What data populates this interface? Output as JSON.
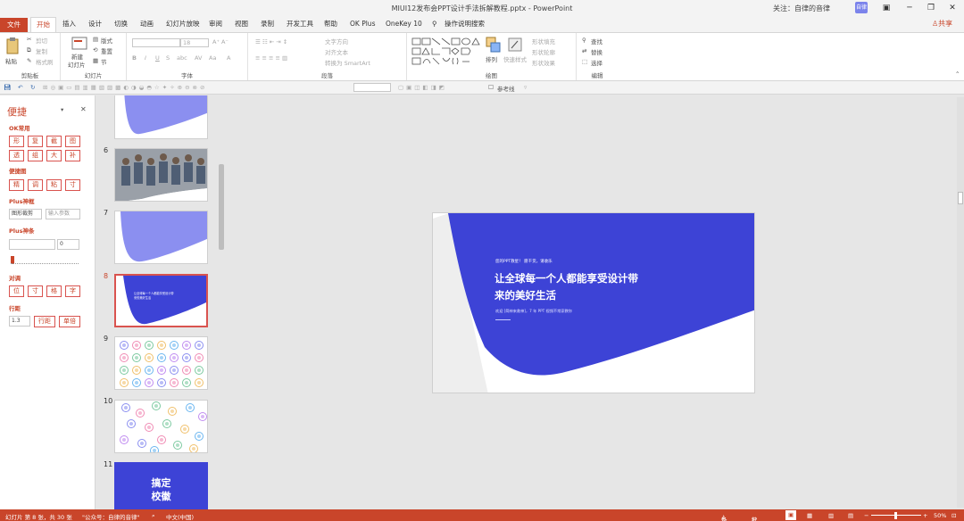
{
  "window": {
    "title": "MIUI12发布会PPT设计手法拆解教程.pptx  -  PowerPoint",
    "follow_label": "关注：自律的音律",
    "avatar_text": "自律"
  },
  "tabs": [
    "文件",
    "开始",
    "插入",
    "设计",
    "切换",
    "动画",
    "幻灯片放映",
    "审阅",
    "视图",
    "录制",
    "开发工具",
    "帮助",
    "OK Plus",
    "OneKey 10"
  ],
  "tell_me": "操作说明搜索",
  "share_label": "共享",
  "ribbon": {
    "clipboard": {
      "label": "剪贴板",
      "paste": "粘贴",
      "cut": "剪切",
      "copy": "复制",
      "format_painter": "格式刷"
    },
    "slides": {
      "label": "幻灯片",
      "new_slide": "新建",
      "new_slide2": "幻灯片",
      "layout": "版式",
      "reset": "重置",
      "section": "节"
    },
    "font": {
      "label": "字体",
      "size": "18"
    },
    "paragraph": {
      "label": "段落",
      "text_direction": "文字方向",
      "align_text": "对齐文本",
      "smartart": "转换为 SmartArt"
    },
    "drawing": {
      "label": "绘图",
      "arrange": "排列",
      "quick_styles": "快速样式",
      "shape_fill": "形状填充",
      "shape_outline": "形状轮廓",
      "shape_effects": "形状效果"
    },
    "editing": {
      "label": "编辑",
      "find": "查找",
      "replace": "替换",
      "select": "选择"
    }
  },
  "quickbar": {
    "guides": "参考线"
  },
  "pane": {
    "title": "便捷",
    "sections": [
      {
        "name": "OK常用",
        "rows": [
          [
            "形",
            "复",
            "截",
            "图"
          ],
          [
            "透",
            "组",
            "大",
            "补"
          ]
        ]
      },
      {
        "name": "便捷图",
        "rows": [
          [
            "精",
            "调",
            "粘",
            "寸"
          ]
        ]
      }
    ],
    "plus_frame": {
      "name": "Plus神框",
      "shape_btn": "图形裁剪",
      "input_placeholder": "输入参数"
    },
    "plus_bar": {
      "name": "Plus神条",
      "value": "0"
    },
    "align": {
      "name": "对调",
      "buttons": [
        "位",
        "寸",
        "格",
        "字"
      ]
    },
    "line": {
      "name": "行距",
      "value": "1.3",
      "btn1": "行距",
      "btn2": "单倍"
    }
  },
  "thumbnails": [
    {
      "num": "6"
    },
    {
      "num": "7"
    },
    {
      "num": "8",
      "current": true,
      "line1": "让全球每一个人都能享受设计带",
      "line2": "来的美好生活"
    },
    {
      "num": "9"
    },
    {
      "num": "10"
    },
    {
      "num": "11",
      "text1": "搞定",
      "text2": "校徽"
    }
  ],
  "slide": {
    "kicker": "您的PPT救星！ 愿干货，请收乐",
    "headline_1": "让全球每一个人都能享受设计带",
    "headline_2": "来的美好生活",
    "subline": "欢迎 [简神来救神]，7 年 PPT 视频不常家教你",
    "color_primary": "#3d43d6",
    "color_light": "#8b8ff0"
  },
  "status": {
    "slide_info": "幻灯片 第 8 张，共 30 张",
    "account": "\"公众号：自律的音律\"",
    "language": "中文(中国)",
    "notes": "备注",
    "comments": "批注",
    "zoom": "50%"
  }
}
